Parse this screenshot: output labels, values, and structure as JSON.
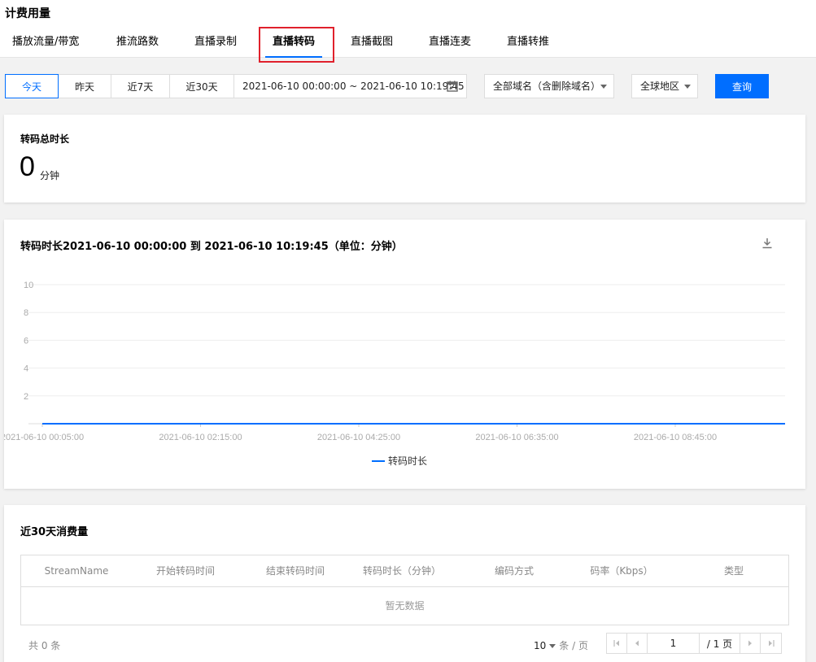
{
  "page": {
    "title": "计费用量"
  },
  "tabs": [
    {
      "label": "播放流量/带宽"
    },
    {
      "label": "推流路数"
    },
    {
      "label": "直播录制"
    },
    {
      "label": "直播转码"
    },
    {
      "label": "直播截图"
    },
    {
      "label": "直播连麦"
    },
    {
      "label": "直播转推"
    }
  ],
  "active_tab": "直播转码",
  "filters": {
    "ranges": [
      "今天",
      "昨天",
      "近7天",
      "近30天"
    ],
    "active_range": "今天",
    "date_range": "2021-06-10 00:00:00 ~ 2021-06-10 10:19:45",
    "domain_select": "全部域名（含删除域名）",
    "region_select": "全球地区",
    "query_button": "查询"
  },
  "summary": {
    "title": "转码总时长",
    "value": "0",
    "unit": "分钟"
  },
  "chart_data": {
    "type": "line",
    "title": "转码时长2021-06-10 00:00:00 到 2021-06-10 10:19:45（单位：分钟）",
    "xlabel": "",
    "ylabel": "",
    "ylim": [
      0,
      10
    ],
    "y_ticks": [
      "2",
      "4",
      "6",
      "8",
      "10"
    ],
    "x_tick_labels": [
      "2021-06-10 00:05:00",
      "2021-06-10 02:15:00",
      "2021-06-10 04:25:00",
      "2021-06-10 06:35:00",
      "2021-06-10 08:45:00"
    ],
    "series": [
      {
        "name": "转码时长",
        "values": [
          0,
          0,
          0,
          0,
          0
        ],
        "color": "#006eff"
      }
    ],
    "grid": true,
    "legend": "bottom-center"
  },
  "table_section": {
    "title": "近30天消费量",
    "columns": [
      "StreamName",
      "开始转码时间",
      "结束转码时间",
      "转码时长（分钟）",
      "编码方式",
      "码率（Kbps）",
      "类型"
    ],
    "empty_text": "暂无数据"
  },
  "pagination": {
    "total_text": "共 0 条",
    "page_size": "10",
    "page_size_unit": "条 / 页",
    "current_page": "1",
    "total_pages": "/ 1 页"
  },
  "colors": {
    "accent": "#006eff",
    "highlight": "#e0212c"
  }
}
